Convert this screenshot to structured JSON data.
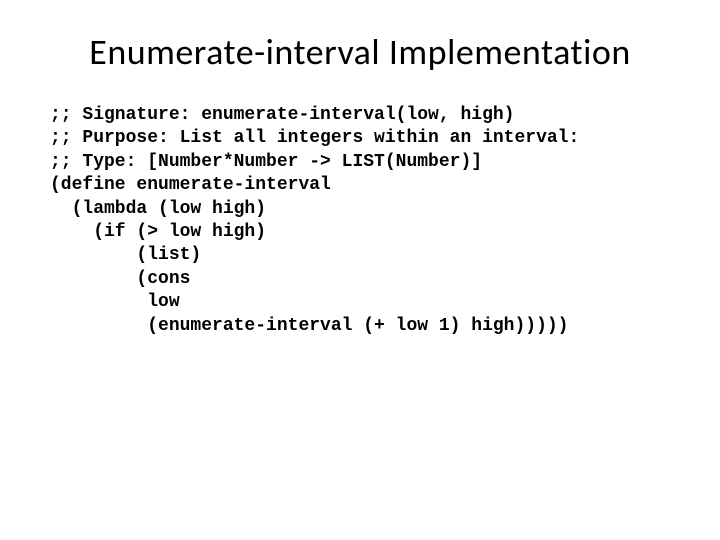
{
  "title": "Enumerate-interval Implementation",
  "code": {
    "line1": ";; Signature: enumerate-interval(low, high)",
    "line2": ";; Purpose: List all integers within an interval:",
    "line3": ";; Type: [Number*Number -> LIST(Number)]",
    "line4": "(define enumerate-interval",
    "line5": "  (lambda (low high)",
    "line6": "    (if (> low high)",
    "line7": "        (list)",
    "line8": "        (cons",
    "line9": "         low",
    "line10": "         (enumerate-interval (+ low 1) high)))))"
  }
}
